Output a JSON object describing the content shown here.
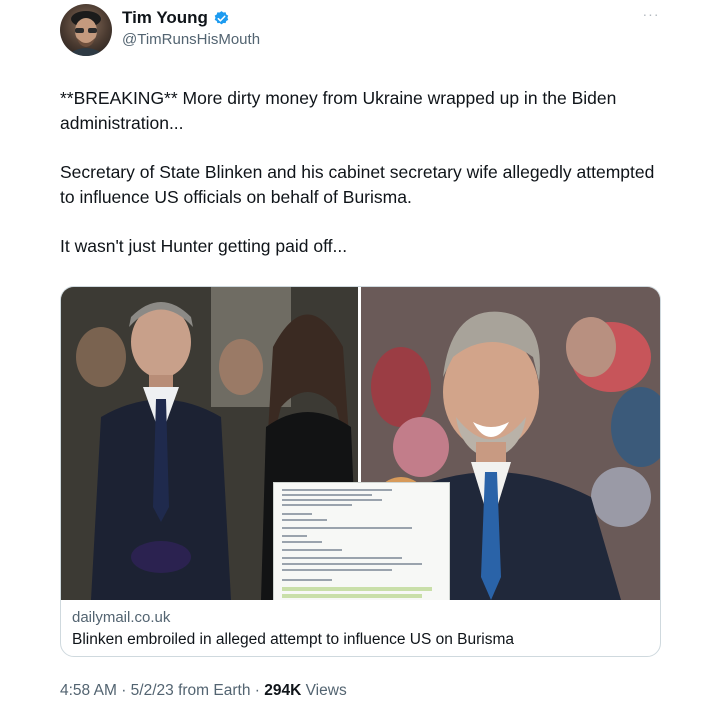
{
  "author": {
    "display_name": "Tim Young",
    "handle": "@TimRunsHisMouth",
    "verified": true,
    "verified_color": "#1d9bf0"
  },
  "more_label": "···",
  "tweet": {
    "paragraphs": [
      "**BREAKING** More dirty money from Ukraine wrapped up in the Biden administration...",
      "Secretary of State Blinken and his cabinet secretary wife allegedly attempted to influence US officials on behalf of Burisma.",
      "It wasn't just Hunter getting paid off..."
    ]
  },
  "card": {
    "domain": "dailymail.co.uk",
    "title": "Blinken embroiled in alleged attempt to influence US on Burisma"
  },
  "meta": {
    "time": "4:58 AM",
    "date": "5/2/23",
    "source": "from Earth",
    "views_count": "294K",
    "views_label": "Views"
  },
  "separator": "·"
}
